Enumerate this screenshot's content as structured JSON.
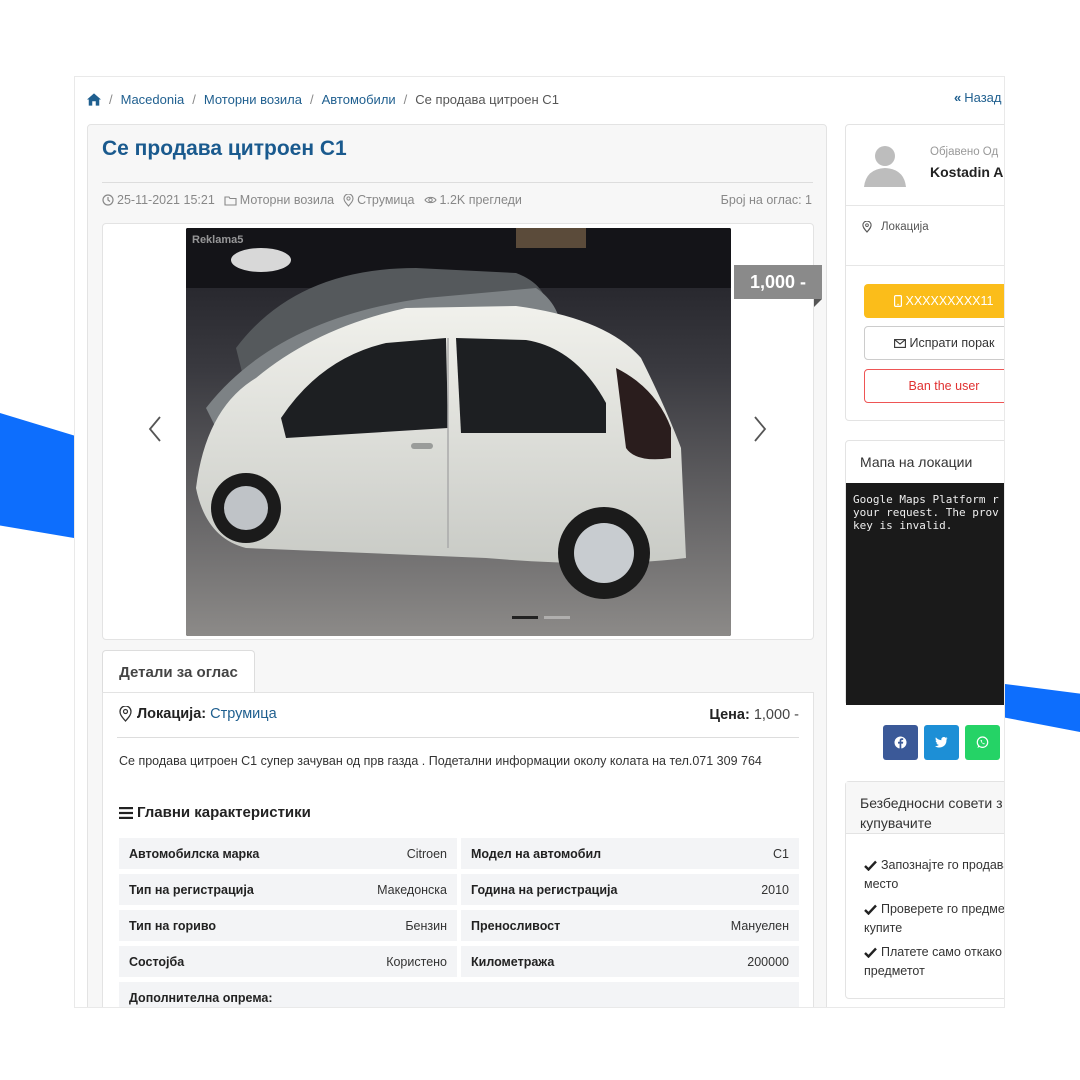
{
  "breadcrumb": {
    "items": [
      "Macedonia",
      "Моторни возила",
      "Автомобили"
    ],
    "current": "Се продава цитроен C1"
  },
  "back_link": "Назад",
  "listing": {
    "title": "Се продава цитроен C1",
    "date": "25-11-2021 15:21",
    "category": "Моторни возила",
    "city": "Струмица",
    "views": "1.2K прегледи",
    "ad_number": "Број на оглас: 1",
    "price_tag": "1,000 -",
    "photo_watermark": "Reklama5",
    "photo_count": 2,
    "active_photo": 1
  },
  "details": {
    "tab_label": "Детали за оглас",
    "location_label": "Локација:",
    "location_value": "Струмица",
    "price_label": "Цена:",
    "price_value": "1,000 -",
    "description": "Се продава цитроен C1 супер зачуван од прв газда . Подетални информации околу колата на тел.071 309 764",
    "features_title": "Главни карактеристики",
    "specs": [
      {
        "key": "Автомобилска марка",
        "value": "Citroen"
      },
      {
        "key": "Модел на автомобил",
        "value": "C1"
      },
      {
        "key": "Тип на регистрација",
        "value": "Македонска"
      },
      {
        "key": "Година на регистрација",
        "value": "2010"
      },
      {
        "key": "Тип на гориво",
        "value": "Бензин"
      },
      {
        "key": "Преносливост",
        "value": "Мануелен"
      },
      {
        "key": "Состојба",
        "value": "Користено"
      },
      {
        "key": "Километража",
        "value": "200000"
      },
      {
        "key": "Дополнителна опрема:",
        "value": ""
      }
    ]
  },
  "seller": {
    "posted_by_label": "Објавено Од",
    "name": "Kostadin An",
    "location_label": "Локација",
    "phone_button": "XXXXXXXXX11",
    "message_button": "Испрати порак",
    "ban_button": "Ban the user"
  },
  "map": {
    "title": "Мапа на локации",
    "error_text": "Google Maps Platform r\nyour request. The prov\nkey is invalid."
  },
  "share": [
    "facebook-icon",
    "twitter-icon",
    "whatsapp-icon"
  ],
  "safety": {
    "title": "Безбедносни совети з купувачите",
    "tips": [
      "Запознајте го продава јавно место",
      "Проверете го предмет да го купите",
      "Платете само откако соберете предметот"
    ]
  },
  "colors": {
    "accent": "#1a5a8e",
    "phone": "#fbbd1a",
    "ban": "#e03131",
    "decor": "#0d6efd"
  }
}
